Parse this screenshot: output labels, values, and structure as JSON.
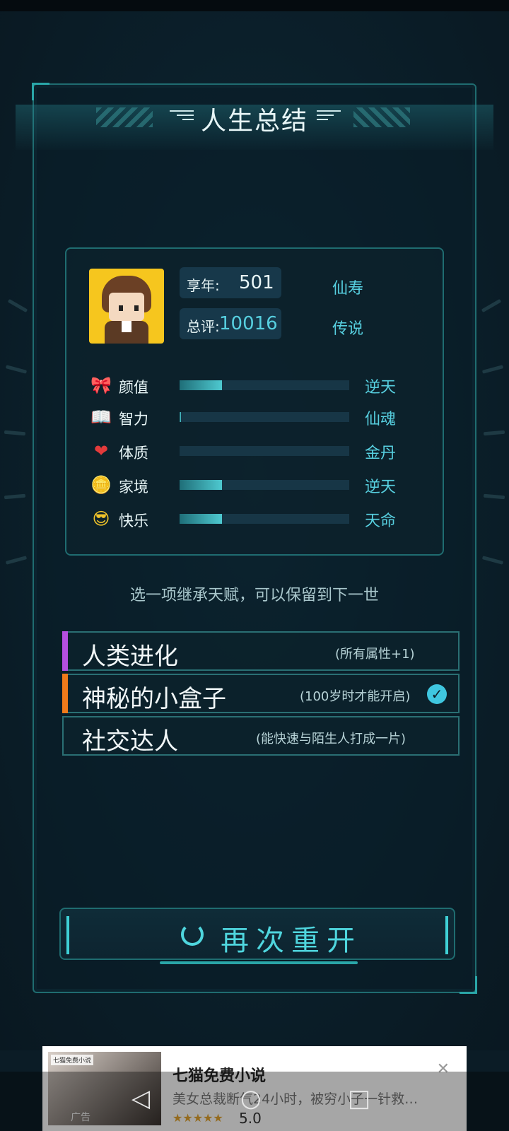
{
  "header": {
    "title": "人生总结"
  },
  "summary": {
    "age_label": "享年:",
    "age_value": "501",
    "age_rank": "仙寿",
    "score_label": "总评:",
    "score_value": "10016",
    "score_rank": "传说"
  },
  "attributes": [
    {
      "label": "颜值",
      "icon": "bow-icon",
      "rank": "逆天",
      "level": 0.25
    },
    {
      "label": "智力",
      "icon": "book-icon",
      "rank": "仙魂",
      "level": 0.01
    },
    {
      "label": "体质",
      "icon": "heart-icon",
      "rank": "金丹",
      "level": 0.0
    },
    {
      "label": "家境",
      "icon": "coin-icon",
      "rank": "逆天",
      "level": 0.25
    },
    {
      "label": "快乐",
      "icon": "sunglasses-face-icon",
      "rank": "天命",
      "level": 0.25
    }
  ],
  "inherit_hint": "选一项继承天赋，可以保留到下一世",
  "talents": [
    {
      "name": "人类进化",
      "desc": "(所有属性+1)",
      "color": "#b44fe0",
      "selected": false
    },
    {
      "name": "神秘的小盒子",
      "desc": "(100岁时才能开启)",
      "color": "#f07a1a",
      "selected": true
    },
    {
      "name": "社交达人",
      "desc": "(能快速与陌生人打成一片)",
      "color": "",
      "selected": false
    }
  ],
  "restart": {
    "label": "再次重开"
  },
  "ad": {
    "badge": "七猫免费小说",
    "tag": "广告",
    "title": "七猫免费小说",
    "desc": "美女总裁断气24小时，被穷小子一针救…",
    "stars": "★★★★★",
    "rating": "5.0"
  },
  "colors": {
    "accent": "#4fd6de",
    "rank": "#57d0e0",
    "panel_border": "#1f6c70"
  }
}
